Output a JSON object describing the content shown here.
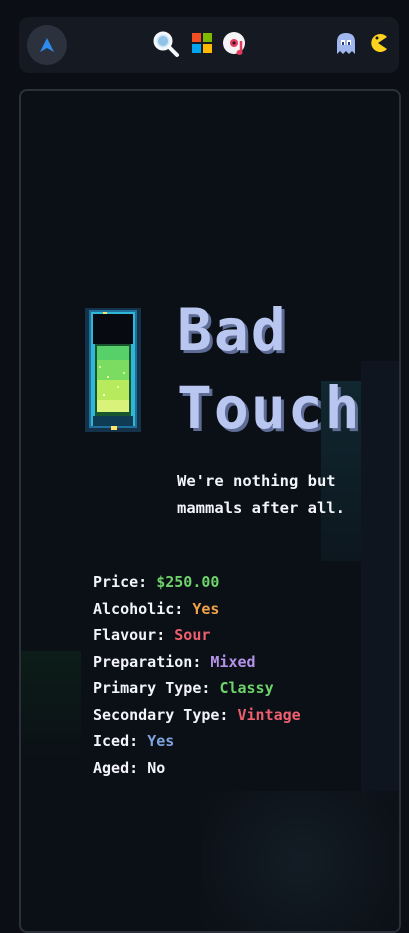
{
  "topbar": {
    "icons": [
      "arrow-up-logo-icon",
      "search-icon",
      "windows-icon",
      "music-disc-icon",
      "ghost-icon",
      "pacman-icon"
    ]
  },
  "drink": {
    "name_line1": "Bad",
    "name_line2": "Touch",
    "tagline": "We're nothing but mammals after all.",
    "specs": [
      {
        "label": "Price:",
        "value": "$250.00",
        "color": "#6dd36a"
      },
      {
        "label": "Alcoholic:",
        "value": "Yes",
        "color": "#f0a24a"
      },
      {
        "label": "Flavour:",
        "value": "Sour",
        "color": "#ef5f6e"
      },
      {
        "label": "Preparation:",
        "value": "Mixed",
        "color": "#b592e8"
      },
      {
        "label": "Primary Type:",
        "value": "Classy",
        "color": "#6dd36a"
      },
      {
        "label": "Secondary Type:",
        "value": "Vintage",
        "color": "#ef5f6e"
      },
      {
        "label": "Iced:",
        "value": "Yes",
        "color": "#7fa3df"
      },
      {
        "label": "Aged:",
        "value": "No",
        "color": "#f2f4f8"
      }
    ]
  },
  "colors": {
    "title": "#b9c7f0",
    "accent_blue": "#3aa0ff",
    "card_border": "#2b313b"
  }
}
